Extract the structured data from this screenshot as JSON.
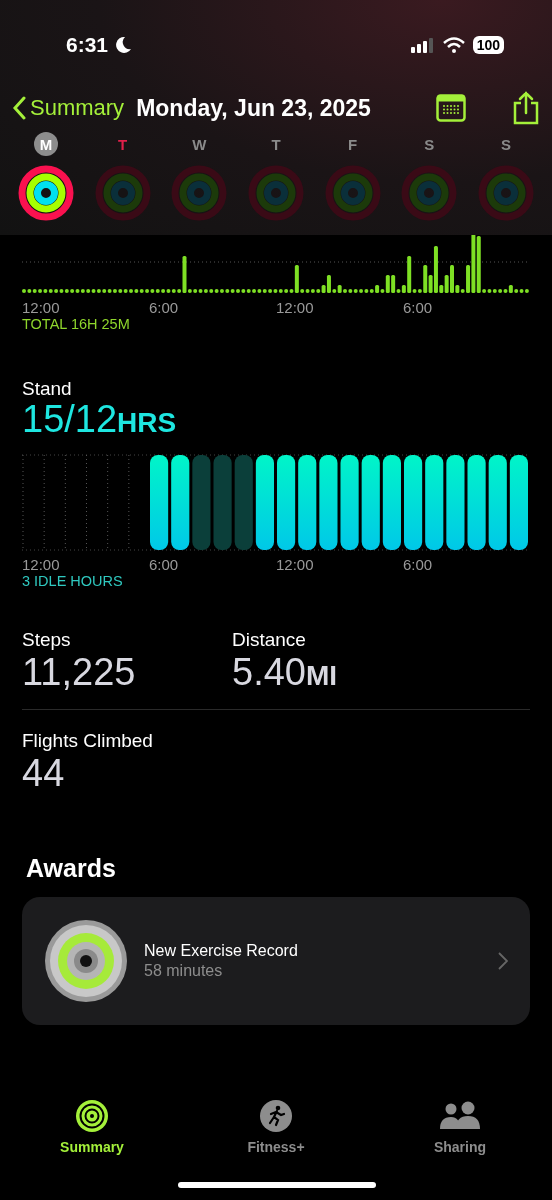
{
  "status_bar": {
    "time": "6:31",
    "battery": "100"
  },
  "nav": {
    "back": "Summary",
    "title": "Monday, Jun 23, 2025"
  },
  "week": [
    {
      "letter": "M",
      "selected": true,
      "highlighted": false,
      "rings_closed": true
    },
    {
      "letter": "T",
      "selected": false,
      "highlighted": true,
      "rings_closed": false
    },
    {
      "letter": "W",
      "selected": false,
      "highlighted": false,
      "rings_closed": false
    },
    {
      "letter": "T",
      "selected": false,
      "highlighted": false,
      "rings_closed": false
    },
    {
      "letter": "F",
      "selected": false,
      "highlighted": false,
      "rings_closed": false
    },
    {
      "letter": "S",
      "selected": false,
      "highlighted": false,
      "rings_closed": false
    },
    {
      "letter": "S",
      "selected": false,
      "highlighted": false,
      "rings_closed": false
    }
  ],
  "exercise": {
    "ticks": [
      "12:00",
      "6:00",
      "12:00",
      "6:00"
    ],
    "total": "TOTAL 16H 25M"
  },
  "stand": {
    "label": "Stand",
    "value": "15/12",
    "unit": "HRS",
    "ticks": [
      "12:00",
      "6:00",
      "12:00",
      "6:00"
    ],
    "idle": "3 IDLE HOURS",
    "hours": [
      {
        "kind": "empty"
      },
      {
        "kind": "empty"
      },
      {
        "kind": "empty"
      },
      {
        "kind": "empty"
      },
      {
        "kind": "empty"
      },
      {
        "kind": "empty"
      },
      {
        "kind": "stood"
      },
      {
        "kind": "stood"
      },
      {
        "kind": "idle"
      },
      {
        "kind": "idle"
      },
      {
        "kind": "idle"
      },
      {
        "kind": "stood"
      },
      {
        "kind": "stood"
      },
      {
        "kind": "stood"
      },
      {
        "kind": "stood"
      },
      {
        "kind": "stood"
      },
      {
        "kind": "stood"
      },
      {
        "kind": "stood"
      },
      {
        "kind": "stood"
      },
      {
        "kind": "stood"
      },
      {
        "kind": "stood"
      },
      {
        "kind": "stood"
      },
      {
        "kind": "stood"
      },
      {
        "kind": "stood"
      }
    ]
  },
  "metrics": [
    {
      "label": "Steps",
      "value": "11,225"
    },
    {
      "label": "Distance",
      "value": "5.40",
      "unit": "MI"
    }
  ],
  "flights": {
    "label": "Flights Climbed",
    "value": "44"
  },
  "awards": {
    "heading": "Awards",
    "items": [
      {
        "title": "New Exercise Record",
        "subtitle": "58 minutes"
      }
    ]
  },
  "tabs": [
    {
      "label": "Summary",
      "selected": true
    },
    {
      "label": "Fitness+",
      "selected": false
    },
    {
      "label": "Sharing",
      "selected": false
    }
  ]
}
